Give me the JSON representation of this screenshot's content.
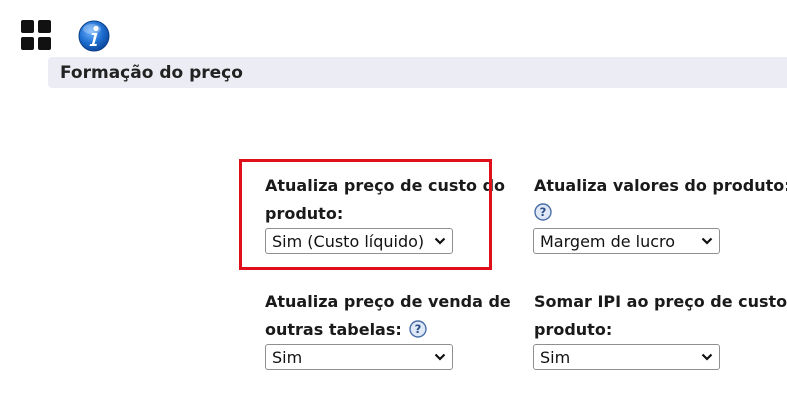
{
  "toolbar": {
    "grid_icon": "grid-icon",
    "info_icon": "info-icon"
  },
  "section": {
    "title": "Formação do preço"
  },
  "fields": {
    "cost_price": {
      "label_line1": "Atualiza preço de custo do",
      "label_line2": "produto:",
      "value": "Sim (Custo líquido)"
    },
    "product_values": {
      "label_line1": "Atualiza valores do produto:",
      "value": "Margem de lucro"
    },
    "other_tables": {
      "label_line1": "Atualiza preço de venda de",
      "label_line2": "outras tabelas:",
      "value": "Sim"
    },
    "ipi": {
      "label_line1": "Somar IPI ao preço de custo do",
      "label_line2": "produto:",
      "value": "Sim"
    }
  },
  "colors": {
    "highlight": "#e0101b",
    "header_bg": "#ececf4",
    "info_blue": "#1f6fd1"
  }
}
